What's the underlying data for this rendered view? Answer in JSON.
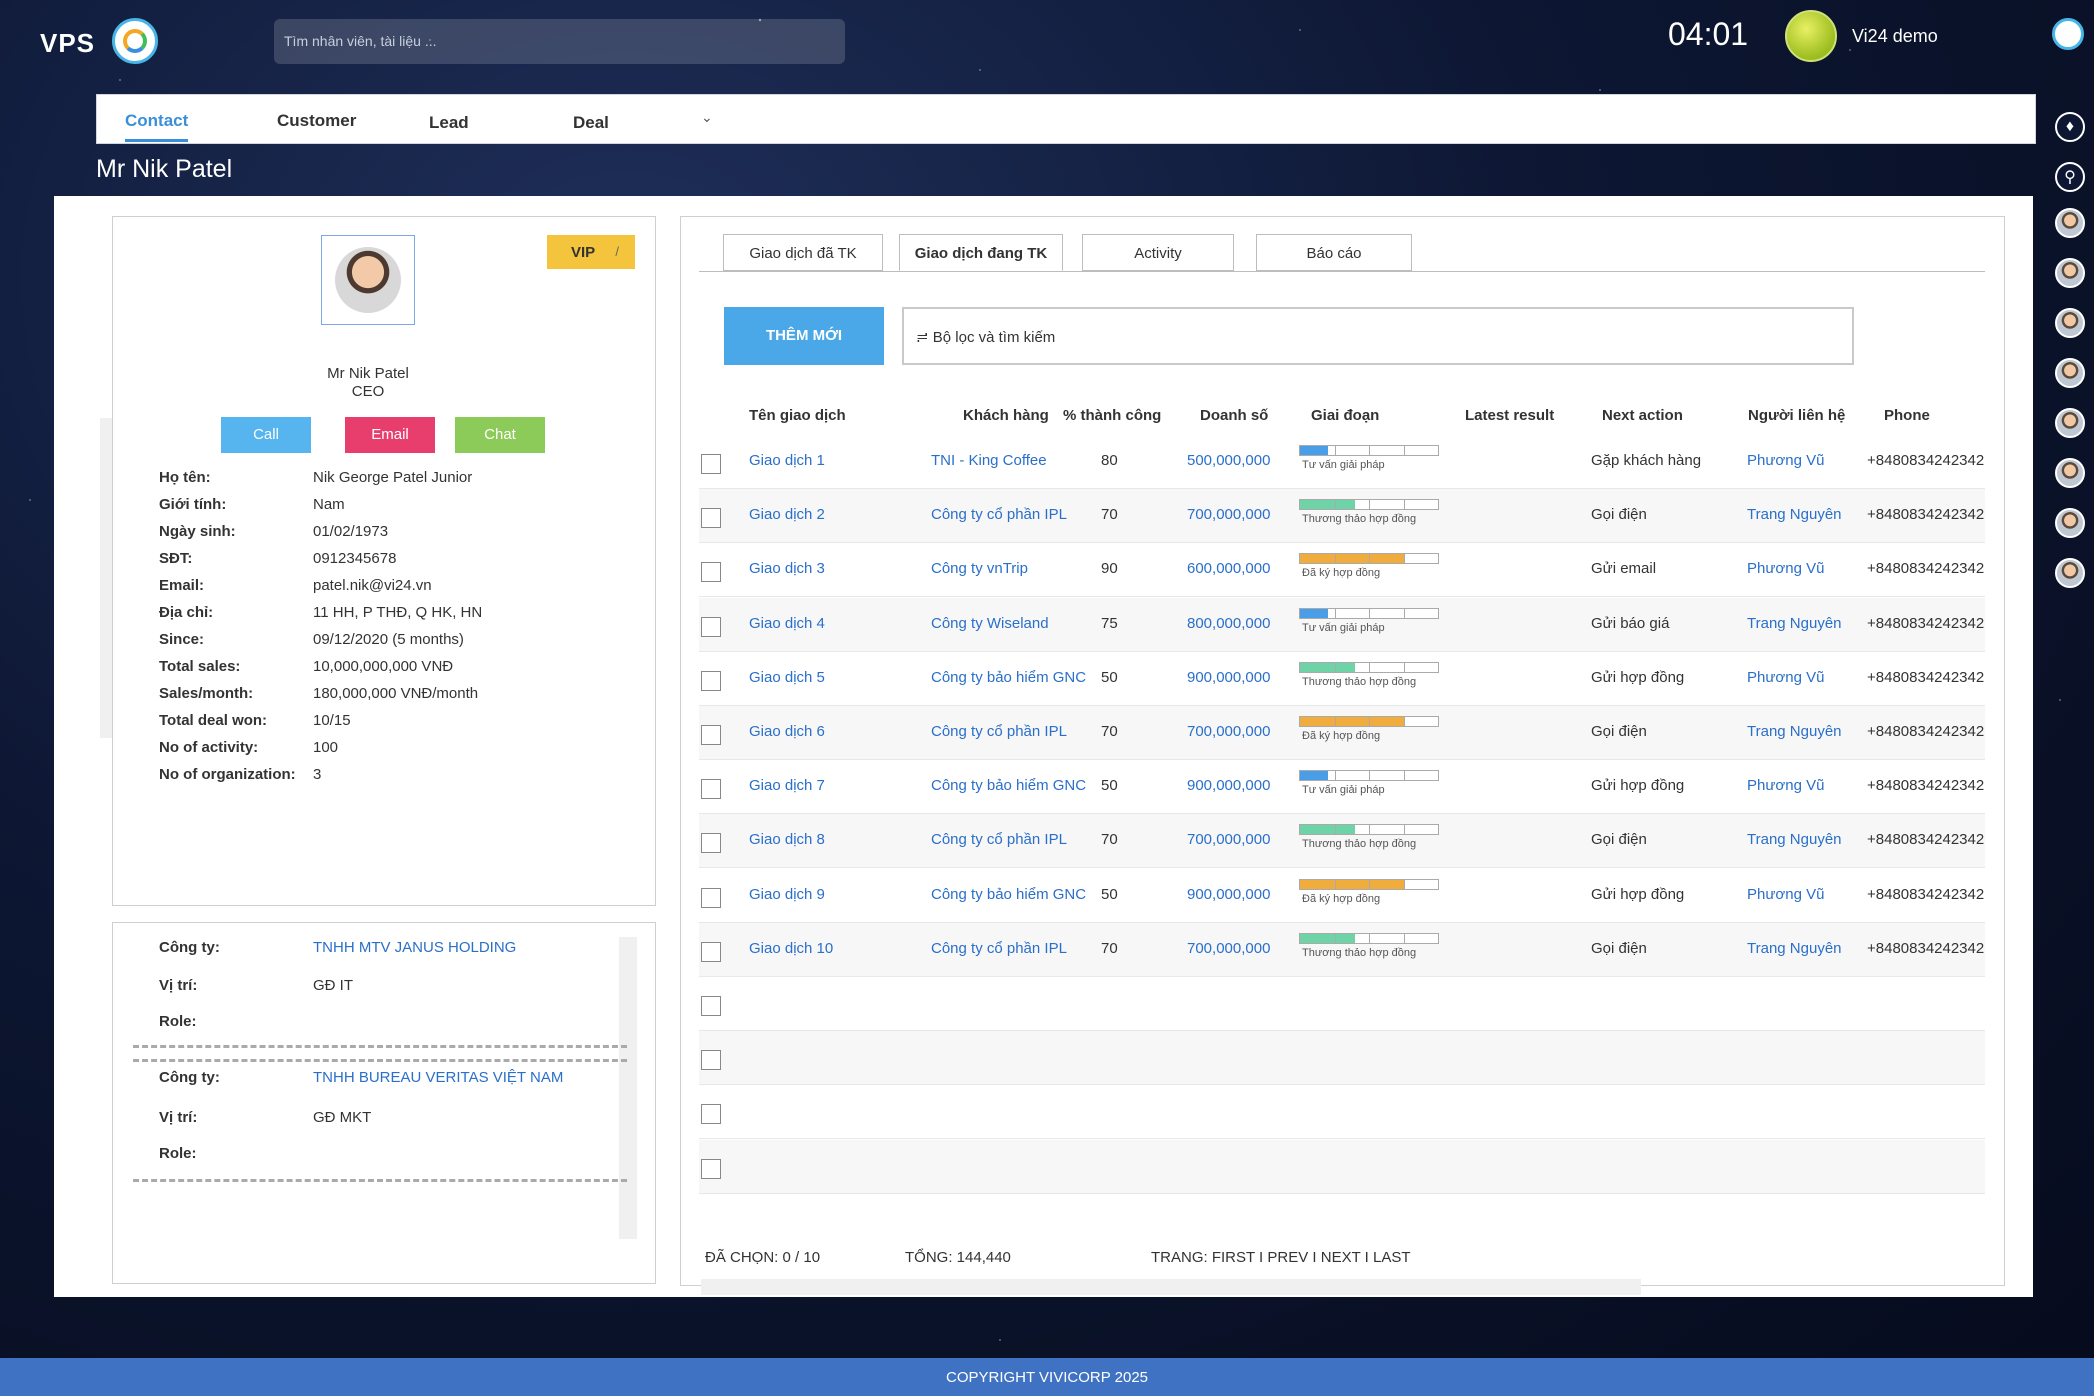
{
  "topbar": {
    "brand": "VPS",
    "search_placeholder": "Tìm nhân viên, tài liệu ...",
    "clock": "04:01",
    "user_name": "Vi24 demo"
  },
  "tabs": [
    "Contact",
    "Customer",
    "Lead",
    "Deal"
  ],
  "page_title": "Mr Nik Patel",
  "profile": {
    "badge": "VIP",
    "badge_edit": "/",
    "name": "Mr Nik Patel",
    "role": "CEO",
    "buttons": {
      "call": "Call",
      "email": "Email",
      "chat": "Chat"
    },
    "fields": [
      {
        "label": "Họ tên:",
        "value": "Nik George Patel Junior"
      },
      {
        "label": "Giới tính:",
        "value": "Nam"
      },
      {
        "label": "Ngày sinh:",
        "value": "01/02/1973"
      },
      {
        "label": "SĐT:",
        "value": "0912345678"
      },
      {
        "label": "Email:",
        "value": "patel.nik@vi24.vn"
      },
      {
        "label": "Địa chỉ:",
        "value": "11 HH, P THĐ, Q HK, HN"
      },
      {
        "label": "Since:",
        "value": "09/12/2020 (5 months)"
      },
      {
        "label": "Total sales:",
        "value": "10,000,000,000 VNĐ"
      },
      {
        "label": "Sales/month:",
        "value": "180,000,000 VNĐ/month"
      },
      {
        "label": "Total deal won:",
        "value": "10/15"
      },
      {
        "label": "No of activity:",
        "value": "100"
      },
      {
        "label": "No of organization:",
        "value": "3"
      }
    ]
  },
  "organizations": [
    {
      "company_label": "Công ty:",
      "company": "TNHH MTV JANUS HOLDING",
      "position_label": "Vị trí:",
      "position": "GĐ IT",
      "role_label": "Role:",
      "role": ""
    },
    {
      "company_label": "Công ty:",
      "company": "TNHH BUREAU VERITAS VIỆT NAM",
      "position_label": "Vị trí:",
      "position": "GĐ MKT",
      "role_label": "Role:",
      "role": ""
    }
  ],
  "deal_tabs": [
    "Giao dịch đã TK",
    "Giao dịch đang TK",
    "Activity",
    "Báo cáo"
  ],
  "add_button": "THÊM MỚI",
  "filter_placeholder": "Bộ lọc và tìm kiếm",
  "columns": [
    "Tên giao dịch",
    "Khách hàng",
    "% thành công",
    "Doanh số",
    "Giai đoạn",
    "Latest result",
    "Next action",
    "Người liên hệ",
    "Phone"
  ],
  "deals": [
    {
      "name": "Giao dịch 1",
      "customer": "TNI - King Coffee",
      "success": "80",
      "revenue": "500,000,000",
      "stage": "Tư vấn giải pháp",
      "stage_level": 0.2,
      "stage_color": "#4a9ee8",
      "result": "",
      "next_action": "Gặp khách hàng",
      "contact": "Phương Vũ",
      "phone": "+8480834242342"
    },
    {
      "name": "Giao dịch 2",
      "customer": "Công ty cổ phần IPL",
      "success": "70",
      "revenue": "700,000,000",
      "stage": "Thương thảo hợp đồng",
      "stage_level": 0.4,
      "stage_color": "#6fd3a8",
      "result": "",
      "next_action": "Gọi điện",
      "contact": "Trang Nguyên",
      "phone": "+8480834242342"
    },
    {
      "name": "Giao dịch 3",
      "customer": "Công ty vnTrip",
      "success": "90",
      "revenue": "600,000,000",
      "stage": "Đã ký hợp đồng",
      "stage_level": 0.75,
      "stage_color": "#f0ad3e",
      "result": "",
      "next_action": "Gửi email",
      "contact": "Phương Vũ",
      "phone": "+8480834242342"
    },
    {
      "name": "Giao dịch 4",
      "customer": "Công ty Wiseland",
      "success": "75",
      "revenue": "800,000,000",
      "stage": "Tư vấn giải pháp",
      "stage_level": 0.2,
      "stage_color": "#4a9ee8",
      "result": "",
      "next_action": "Gửi báo giá",
      "contact": "Trang Nguyên",
      "phone": "+8480834242342"
    },
    {
      "name": "Giao dịch 5",
      "customer": "Công ty bảo hiểm GNC",
      "success": "50",
      "revenue": "900,000,000",
      "stage": "Thương thảo hợp đồng",
      "stage_level": 0.4,
      "stage_color": "#6fd3a8",
      "result": "",
      "next_action": "Gửi hợp đồng",
      "contact": "Phương Vũ",
      "phone": "+8480834242342"
    },
    {
      "name": "Giao dịch 6",
      "customer": "Công ty cổ phần IPL",
      "success": "70",
      "revenue": "700,000,000",
      "stage": "Đã ký hợp đồng",
      "stage_level": 0.75,
      "stage_color": "#f0ad3e",
      "result": "",
      "next_action": "Gọi điện",
      "contact": "Trang Nguyên",
      "phone": "+8480834242342"
    },
    {
      "name": "Giao dịch 7",
      "customer": "Công ty bảo hiểm GNC",
      "success": "50",
      "revenue": "900,000,000",
      "stage": "Tư vấn giải pháp",
      "stage_level": 0.2,
      "stage_color": "#4a9ee8",
      "result": "",
      "next_action": "Gửi hợp đồng",
      "contact": "Phương Vũ",
      "phone": "+8480834242342"
    },
    {
      "name": "Giao dịch 8",
      "customer": "Công ty cổ phần IPL",
      "success": "70",
      "revenue": "700,000,000",
      "stage": "Thương thảo hợp đồng",
      "stage_level": 0.4,
      "stage_color": "#6fd3a8",
      "result": "",
      "next_action": "Gọi điện",
      "contact": "Trang Nguyên",
      "phone": "+8480834242342"
    },
    {
      "name": "Giao dịch 9",
      "customer": "Công ty bảo hiểm GNC",
      "success": "50",
      "revenue": "900,000,000",
      "stage": "Đã ký hợp đồng",
      "stage_level": 0.75,
      "stage_color": "#f0ad3e",
      "result": "",
      "next_action": "Gửi hợp đồng",
      "contact": "Phương Vũ",
      "phone": "+8480834242342"
    },
    {
      "name": "Giao dịch 10",
      "customer": "Công ty cổ phần IPL",
      "success": "70",
      "revenue": "700,000,000",
      "stage": "Thương thảo hợp đồng",
      "stage_level": 0.4,
      "stage_color": "#6fd3a8",
      "result": "",
      "next_action": "Gọi điện",
      "contact": "Trang Nguyên",
      "phone": "+8480834242342"
    }
  ],
  "footer_bar": {
    "selected": "ĐÃ CHỌN: 0 / 10",
    "total": "TỔNG: 144,440",
    "paging": "TRANG:  FIRST I PREV  I NEXT I LAST"
  },
  "copyright": "COPYRIGHT VIVICORP 2025",
  "colors": {
    "accent": "#3a8fd8",
    "link": "#2a6fc9",
    "call": "#56b4ee",
    "email": "#e73e6e",
    "chat": "#8ccb5a",
    "vip": "#f4c53c",
    "footer": "#3f72c3"
  },
  "side_icons": [
    "bell-icon",
    "search-icon",
    "avatar",
    "avatar",
    "avatar",
    "avatar",
    "avatar",
    "avatar",
    "avatar",
    "avatar"
  ]
}
